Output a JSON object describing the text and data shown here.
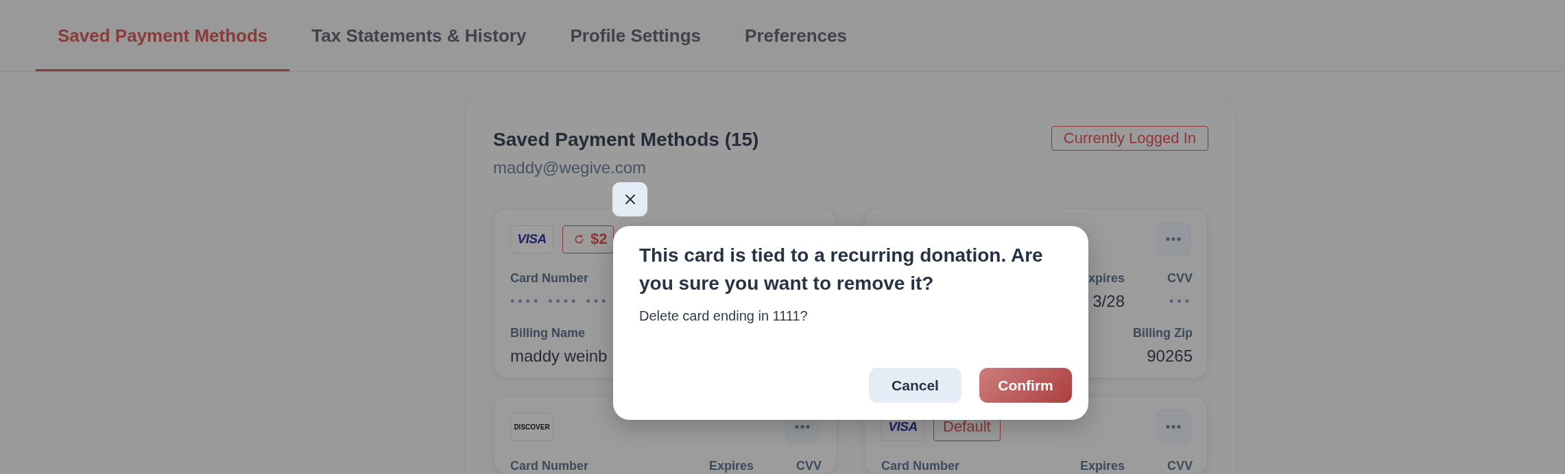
{
  "tabs": [
    {
      "label": "Saved Payment Methods",
      "selected": true
    },
    {
      "label": "Tax Statements & History",
      "selected": false
    },
    {
      "label": "Profile Settings",
      "selected": false
    },
    {
      "label": "Preferences",
      "selected": false
    }
  ],
  "payment_methods": {
    "title": "Saved Payment Methods (15)",
    "email": "maddy@wegive.com",
    "status_badge": "Currently Logged In",
    "cards": [
      {
        "logo": {
          "kind": "visa",
          "text": "VISA"
        },
        "badge": {
          "kind": "recurring",
          "text": "$2"
        },
        "actions_button": false,
        "card_number": {
          "label": "Card Number",
          "value": "•••• •••• •••"
        },
        "billing_name": {
          "label": "Billing Name",
          "value": "maddy weinb"
        }
      },
      {
        "actions_button": true,
        "expires": {
          "label": "xpires",
          "value": "3/28"
        },
        "cvv": {
          "label": "CVV",
          "value": "•••"
        },
        "billing_zip": {
          "label": "Billing Zip",
          "value": "90265"
        }
      },
      {
        "logo": {
          "kind": "discover",
          "text": "DISCOVER"
        },
        "actions_button": true,
        "card_number": {
          "label": "Card Number"
        },
        "expires": {
          "label": "Expires"
        },
        "cvv": {
          "label": "CVV"
        }
      },
      {
        "logo": {
          "kind": "visa",
          "text": "VISA"
        },
        "badge": {
          "kind": "default",
          "text": "Default"
        },
        "actions_button": true,
        "card_number": {
          "label": "Card Number"
        },
        "expires": {
          "label": "Expires"
        },
        "cvv": {
          "label": "CVV"
        }
      }
    ]
  },
  "dialog": {
    "title": "This card is tied to a recurring donation. Are you sure you want to remove it?",
    "message": "Delete card ending in 1111?",
    "buttons": [
      {
        "label": "Cancel",
        "kind": "secondary"
      },
      {
        "label": "Confirm",
        "kind": "primary"
      }
    ]
  }
}
